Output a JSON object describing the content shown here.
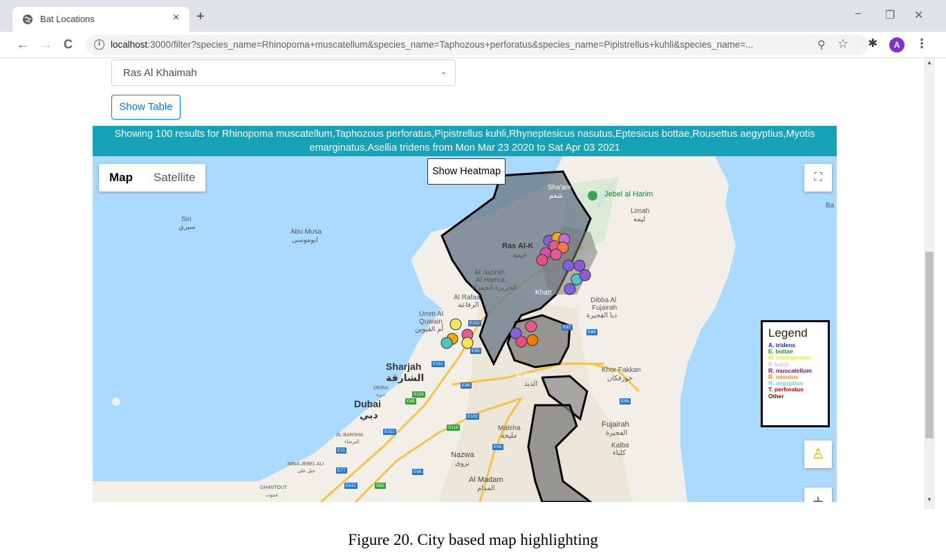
{
  "browser": {
    "tab_title": "Bat Locations",
    "tab_close": "×",
    "new_tab": "+",
    "window_controls": {
      "minimize": "−",
      "restore": "❐",
      "close": "✕"
    },
    "nav": {
      "back": "←",
      "forward": "→",
      "reload": "C"
    },
    "url_host": "localhost",
    "url_rest": ":3000/filter?species_name=Rhinopoma+muscatellum&species_name=Taphozous+perforatus&species_name=Pipistrellus+kuhli&species_name=...",
    "avatar_letter": "A"
  },
  "filters": {
    "city_selected": "Ras Al Khaimah",
    "show_table_label": "Show Table"
  },
  "banner": {
    "text_line1": "Showing 100 results for Rhinopoma muscatellum,Taphozous perforatus,Pipistrellus kuhli,Rhyneptesicus nasutus,Eptesicus bottae,Rousettus aegyptius,Myotis",
    "text_line2": "emarginatus,Asellia tridens from Mon Mar 23 2020 to Sat Apr 03 2021"
  },
  "map": {
    "type_map_label": "Map",
    "type_satellite_label": "Satellite",
    "show_heatmap_label": "Show Heatmap",
    "zoom_in_label": "+",
    "labels": {
      "jebel": "Jebel al Harim",
      "shaam": "Sha'am",
      "shaam_ar": "شعم",
      "limah": "Limah",
      "limah_ar": "ليمة",
      "sirri": "Siri",
      "sirri_ar": "سيري",
      "abu_musa": "Abu Musa",
      "abu_musa_ar": "ابوموسى",
      "ras_al_khaimah": "Ras Al-K",
      "ras_al_khaimah_ar": "خيمة",
      "al_jazirah": "Al Jazirah",
      "al_hamra": "Al Hamra",
      "al_hamra_ar": "الجزيرة الحمراء",
      "al_rafaa": "Al Rafaa",
      "al_rafaa_ar": "الرفاعة",
      "khatt": "Khatt",
      "dibba": "Dibba Al",
      "dibba2": "Fujairah",
      "dibba_ar": "دبا الفجيرة",
      "umm_al_quwain": "Umm Al",
      "umm_al_quwain2": "Quwain",
      "umm_al_quwain_ar": "أم القيوين",
      "sharjah": "Sharjah",
      "sharjah_ar": "الشارقة",
      "deira": "DEIRA",
      "deira_ar": "ديرة",
      "dubai": "Dubai",
      "dubai_ar": "دبي",
      "al_barsha": "AL BARSHA",
      "al_barsha_ar": "البرشاء",
      "mina_jebel_ali": "MINA JEBEL ALI",
      "mina_jebel_ali_ar": "جبل علي",
      "ghantout": "GHANTOUT",
      "ghantout_ar": "غنتوت",
      "al_dhaid": "Al Dhaid",
      "al_dhaid_ar": "الذيد",
      "khor_fakkan": "Khor Fakkan",
      "khor_fakkan_ar": "خورفكان",
      "fujairah": "Fujairah",
      "fujairah_ar": "الفجيرة",
      "kalba": "Kalba",
      "kalba_ar": "كلباء",
      "maleha": "Maleha",
      "maleha_ar": "مليحة",
      "nazwa": "Nazwa",
      "nazwa_ar": "نزوى",
      "al_madam": "Al Madam",
      "al_madam_ar": "المدام",
      "bay": "Ba"
    },
    "shields": [
      "E311",
      "E311",
      "E55",
      "E311",
      "E88",
      "E87",
      "E89",
      "S116",
      "E89",
      "E102",
      "E311",
      "E11",
      "E55",
      "S116",
      "E66",
      "E77",
      "E611",
      "D63",
      "E99"
    ]
  },
  "legend": {
    "title": "Legend",
    "items": [
      {
        "label": "A. tridens",
        "color": "#1f1fd6"
      },
      {
        "label": "E. bottae",
        "color": "#1a9a1a"
      },
      {
        "label": "M. emarginatus",
        "color": "#f0e62a"
      },
      {
        "label": "P. kuhli",
        "color": "#f4b6d8"
      },
      {
        "label": "R. muscatellum",
        "color": "#7a0f7a"
      },
      {
        "label": "R. nasutus",
        "color": "#f08c00"
      },
      {
        "label": "R. aegyptius",
        "color": "#6ec8e8"
      },
      {
        "label": "T. perforatus",
        "color": "#d40000"
      },
      {
        "label": "Other",
        "color": "#7a0000"
      }
    ]
  },
  "caption": "Figure 20. City based map highlighting"
}
